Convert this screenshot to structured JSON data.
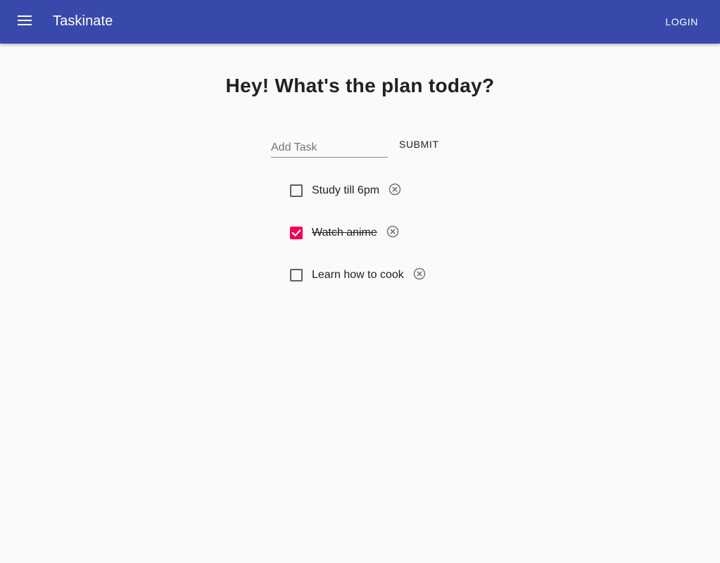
{
  "appbar": {
    "title": "Taskinate",
    "menu_icon": "menu-icon",
    "login_label": "LOGIN",
    "color": "#3949ab"
  },
  "main": {
    "headline": "Hey! What's the plan today?",
    "add_task": {
      "placeholder": "Add Task",
      "value": ""
    },
    "submit_label": "SUBMIT"
  },
  "tasks": [
    {
      "label": "Study till 6pm",
      "checked": false,
      "delete_icon": "cancel-circle-icon"
    },
    {
      "label": "Watch anime",
      "checked": true,
      "delete_icon": "cancel-circle-icon"
    },
    {
      "label": "Learn how to cook",
      "checked": false,
      "delete_icon": "cancel-circle-icon"
    }
  ],
  "colors": {
    "checked_accent": "#f50057",
    "background": "#fafafa"
  }
}
